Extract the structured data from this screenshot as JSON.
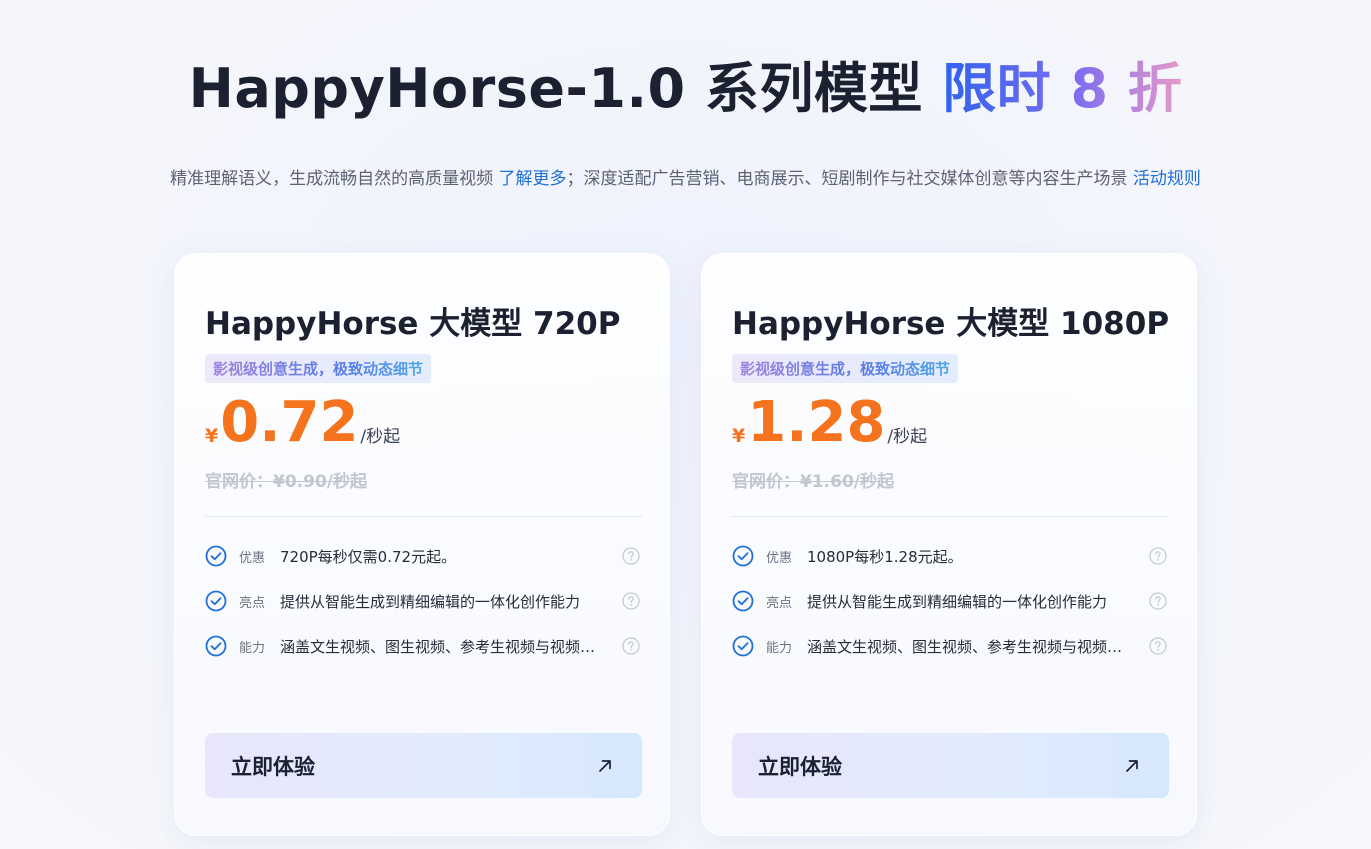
{
  "hero": {
    "title_main": "HappyHorse-1.0 系列模型",
    "title_promo": "限时 8 折"
  },
  "subtitle": {
    "part1": "精准理解语义，生成流畅自然的高质量视频 ",
    "learn_more": "了解更多",
    "part2": "；深度适配广告营销、电商展示、短剧制作与社交媒体创意等内容生产场景 ",
    "rules": "活动规则"
  },
  "cards": [
    {
      "title": "HappyHorse 大模型 720P",
      "tagline": "影视级创意生成，极致动态细节",
      "currency": "¥",
      "price": "0.72",
      "unit": "/秒起",
      "original_price": "官网价：¥0.90/秒起",
      "features": [
        {
          "label": "优惠",
          "text": "720P每秒仅需0.72元起。"
        },
        {
          "label": "亮点",
          "text": "提供从智能生成到精细编辑的一体化创作能力"
        },
        {
          "label": "能力",
          "text": "涵盖文生视频、图生视频、参考生视频与视频编辑"
        }
      ],
      "cta": "立即体验"
    },
    {
      "title": "HappyHorse 大模型 1080P",
      "tagline": "影视级创意生成，极致动态细节",
      "currency": "¥",
      "price": "1.28",
      "unit": "/秒起",
      "original_price": "官网价：¥1.60/秒起",
      "features": [
        {
          "label": "优惠",
          "text": "1080P每秒1.28元起。"
        },
        {
          "label": "亮点",
          "text": "提供从智能生成到精细编辑的一体化创作能力"
        },
        {
          "label": "能力",
          "text": "涵盖文生视频、图生视频、参考生视频与视频编辑"
        }
      ],
      "cta": "立即体验"
    }
  ],
  "icons": {
    "feature": "check-circle-icon",
    "help": "question-circle-icon",
    "cta": "arrow-up-right-icon"
  },
  "colors": {
    "accent_price": "#f4731c",
    "link": "#1f6fd9",
    "check": "#1f6fd9"
  }
}
